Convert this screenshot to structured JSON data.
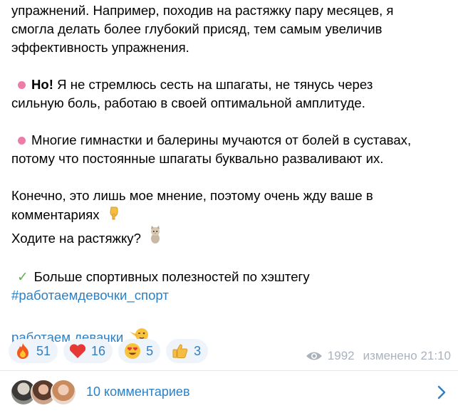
{
  "message": {
    "line1": "упражнений. Например, походив на растяжку пару месяцев, я",
    "line2": "смогла делать более глубокий присяд, тем самым увеличив",
    "line3": "эффективность упражнения.",
    "p2_bold": "Но!",
    "p2_line1_rest": " Я не стремлюсь сесть на шпагаты, не тянусь через",
    "p2_line2": "сильную боль, работаю в своей оптимальной амплитуде.",
    "p3_line1": "Многие гимнастки и балерины мучаются от болей в суставах,",
    "p3_line2": "потому что постоянные шпагаты буквально разваливают их.",
    "p4_line1": "Конечно, это лишь мое мнение, поэтому очень жду ваше в",
    "p4_line2": "комментариях",
    "p4_line3": "Ходите на растяжку?",
    "p5_line1": "Больше спортивных полезностей по хэштегу",
    "hashtag": "#работаемдевочки_спорт",
    "signature": "работаем девачки"
  },
  "icons": {
    "bullet": "pink-circle-icon",
    "pointing_down": "point-down-icon",
    "cat": "cat-icon",
    "check": "check-mark-icon",
    "signature_emoji": "wink-emoji-icon"
  },
  "reactions": [
    {
      "icon": "fire-icon",
      "count": "51"
    },
    {
      "icon": "heart-icon",
      "count": "16"
    },
    {
      "icon": "heart-eyes-icon",
      "count": "5"
    },
    {
      "icon": "thumbs-up-icon",
      "count": "3"
    }
  ],
  "meta": {
    "views": "1992",
    "edited": "изменено 21:10"
  },
  "comments": {
    "label": "10 комментариев"
  },
  "colors": {
    "link": "#2f7fc1",
    "bullet": "#ec7ca9",
    "meta": "#aab3bd",
    "chip_bg": "#eef4fa"
  }
}
